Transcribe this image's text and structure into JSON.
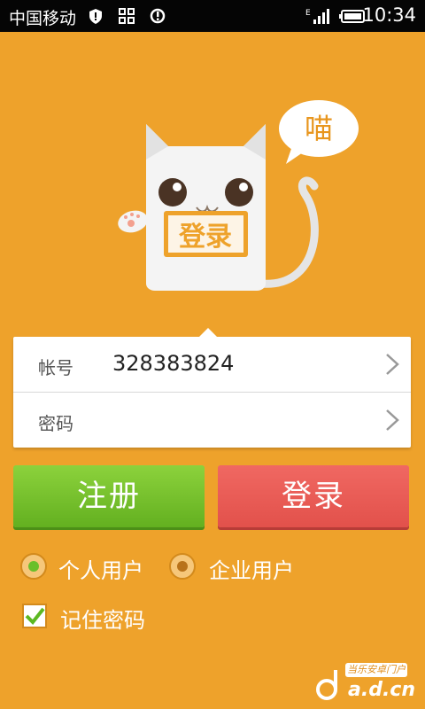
{
  "status_bar": {
    "carrier": "中国移动",
    "time": "10:34",
    "network": "E"
  },
  "mascot": {
    "speech": "喵",
    "sign": "登录"
  },
  "form": {
    "account_label": "帐号",
    "account_value": "328383824",
    "password_label": "密码",
    "password_value": ""
  },
  "buttons": {
    "register": "注册",
    "login": "登录"
  },
  "user_type": {
    "personal": "个人用户",
    "enterprise": "企业用户",
    "selected": "personal"
  },
  "remember": {
    "label": "记住密码",
    "checked": true
  },
  "watermark": {
    "top": "当乐安卓门户",
    "bottom": "a.d.cn"
  },
  "colors": {
    "background": "#eea22b",
    "register": "#75c22a",
    "login": "#e85a55"
  }
}
